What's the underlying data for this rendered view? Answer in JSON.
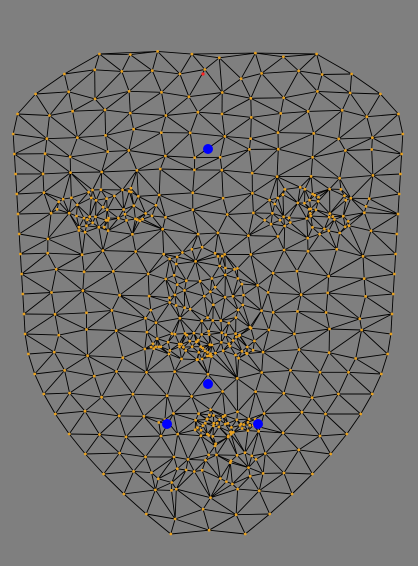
{
  "viewport": {
    "background": "#7f7f7f"
  },
  "mesh": {
    "edge_color": "#000000",
    "vertex_color": "#e6a020",
    "selected_color": "#0000ff",
    "origin_color": "#ff2020",
    "selected_landmarks": [
      "forehead-landmark",
      "upper-lip-landmark",
      "left-mouth-corner-landmark",
      "right-mouth-corner-landmark"
    ]
  }
}
